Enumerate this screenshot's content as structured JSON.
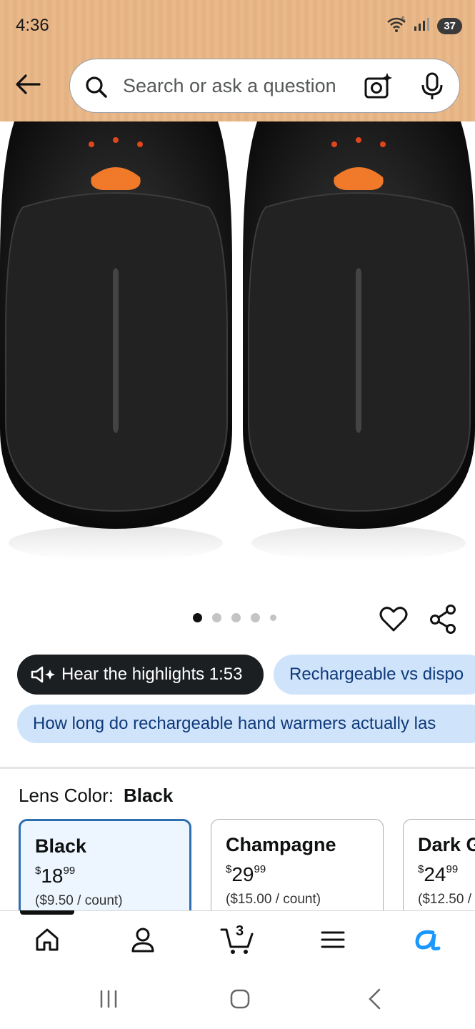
{
  "status_bar": {
    "time": "4:36",
    "battery": "37",
    "wifi_label": "5"
  },
  "search": {
    "placeholder": "Search or ask a question"
  },
  "carousel": {
    "total_dots": 5,
    "active_index": 0
  },
  "chips": {
    "highlights": "Hear the highlights 1:53",
    "question1": "Rechargeable vs dispo",
    "question2": "How long do rechargeable hand warmers actually las"
  },
  "lens": {
    "label": "Lens Color:",
    "value": "Black"
  },
  "options": [
    {
      "name": "Black",
      "price_currency": "$",
      "price_whole": "18",
      "price_fraction": "99",
      "unit_price": "($9.50 / count)",
      "selected": true
    },
    {
      "name": "Champagne",
      "price_currency": "$",
      "price_whole": "29",
      "price_fraction": "99",
      "unit_price": "($15.00 / count)",
      "selected": false
    },
    {
      "name": "Dark G",
      "price_currency": "$",
      "price_whole": "24",
      "price_fraction": "99",
      "unit_price": "($12.50 /",
      "selected": false
    }
  ],
  "bottom_nav": {
    "cart_count": "3",
    "items": [
      "home-icon",
      "account-icon",
      "cart-icon",
      "menu-icon",
      "rufus-icon"
    ]
  },
  "colors": {
    "header_bg": "#e9b98a",
    "chip_blue": "#cfe3fb",
    "selected_border": "#2f6fb0",
    "rufus_blue": "#1a98ff"
  }
}
